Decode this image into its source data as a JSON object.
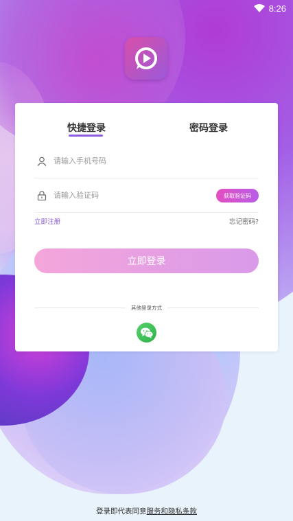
{
  "status_bar": {
    "time": "8:26",
    "icons": [
      "wifi-icon"
    ]
  },
  "logo": {
    "icon": "play-logo-icon",
    "colors": [
      "#d84fa9",
      "#9b59d9"
    ]
  },
  "tabs": [
    {
      "label": "快捷登录",
      "active": true
    },
    {
      "label": "密码登录",
      "active": false
    }
  ],
  "phone_field": {
    "icon": "user-icon",
    "placeholder": "请输入手机号码",
    "value": ""
  },
  "code_field": {
    "icon": "lock-icon",
    "placeholder": "请输入验证码",
    "value": "",
    "button_label": "获取验证码"
  },
  "links": {
    "register": "立即注册",
    "forgot": "忘记密码?"
  },
  "login_button": {
    "label": "立即登录"
  },
  "other_login": {
    "label": "其他登录方式",
    "icon": "wechat-icon"
  },
  "footer": {
    "prefix": "登录即代表同意",
    "terms": "服务和隐私条款"
  },
  "colors": {
    "accent": "#8c5be0",
    "brand_pink": "#e44fc0",
    "wechat": "#2fb24b"
  }
}
